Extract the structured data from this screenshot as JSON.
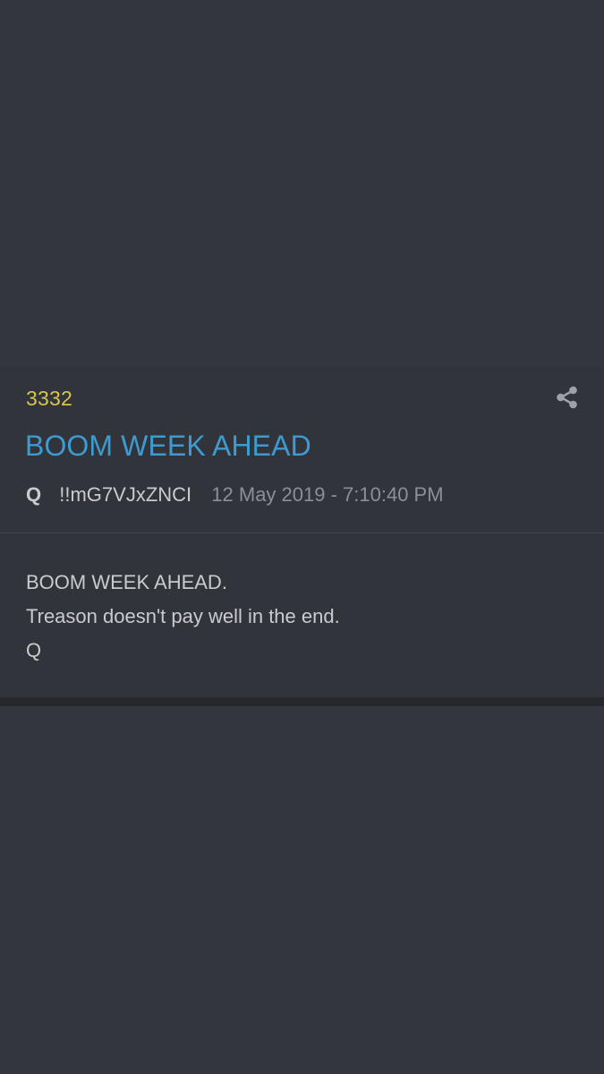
{
  "post": {
    "number": "3332",
    "title": "BOOM WEEK AHEAD",
    "author": "Q",
    "tripcode": "!!mG7VJxZNCI",
    "timestamp": "12 May 2019 - 7:10:40 PM",
    "body_lines": [
      "BOOM WEEK AHEAD.",
      "Treason doesn't pay well in the end.",
      "Q"
    ]
  },
  "icons": {
    "share": "share-icon"
  },
  "colors": {
    "background": "#33363e",
    "post_number": "#d8c451",
    "title": "#3d9bd0",
    "text": "#c9cbcf",
    "timestamp": "#8c8f96"
  }
}
